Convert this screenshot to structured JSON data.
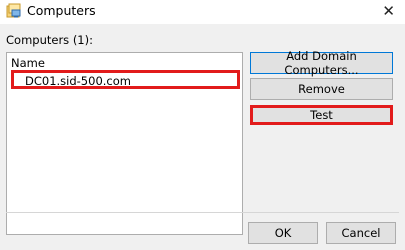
{
  "window": {
    "title": "Computers",
    "icon": "computers-app-icon",
    "close_glyph": "✕"
  },
  "list": {
    "label": "Computers (1):",
    "column_header": "Name",
    "items": [
      {
        "name": "DC01.sid-500.com"
      }
    ]
  },
  "buttons": {
    "add": "Add Domain Computers...",
    "remove": "Remove",
    "test": "Test",
    "ok": "OK",
    "cancel": "Cancel"
  },
  "colors": {
    "highlight": "#e21b1b",
    "focus_border": "#0078d7"
  }
}
